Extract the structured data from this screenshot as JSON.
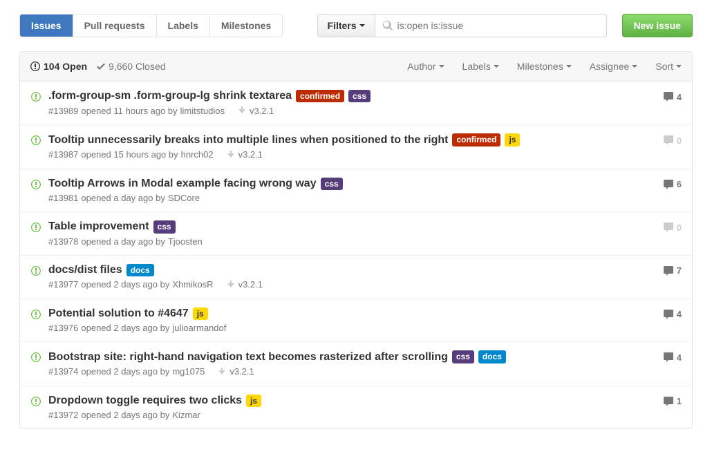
{
  "tabs": {
    "issues": "Issues",
    "pulls": "Pull requests",
    "labels": "Labels",
    "milestones": "Milestones"
  },
  "filters_label": "Filters",
  "search_value": "is:open is:issue",
  "new_issue_label": "New issue",
  "states": {
    "open": "104 Open",
    "closed": "9,660 Closed"
  },
  "sorts": {
    "author": "Author",
    "labels": "Labels",
    "milestones": "Milestones",
    "assignee": "Assignee",
    "sort": "Sort"
  },
  "label_colors": {
    "confirmed": "#bd2c00",
    "css": "#563d7c",
    "js": "#ffd804",
    "docs": "#0088cc"
  },
  "issues": [
    {
      "title": ".form-group-sm .form-group-lg shrink textarea",
      "labels": [
        "confirmed",
        "css"
      ],
      "number": "#13989",
      "opened": "opened 11 hours ago by",
      "author": "limitstudios",
      "milestone": "v3.2.1",
      "comments": 4
    },
    {
      "title": "Tooltip unnecessarily breaks into multiple lines when positioned to the right",
      "labels": [
        "confirmed",
        "js"
      ],
      "number": "#13987",
      "opened": "opened 15 hours ago by",
      "author": "hnrch02",
      "milestone": "v3.2.1",
      "comments": 0
    },
    {
      "title": "Tooltip Arrows in Modal example facing wrong way",
      "labels": [
        "css"
      ],
      "number": "#13981",
      "opened": "opened a day ago by",
      "author": "SDCore",
      "milestone": "",
      "comments": 6
    },
    {
      "title": "Table improvement",
      "labels": [
        "css"
      ],
      "number": "#13978",
      "opened": "opened a day ago by",
      "author": "Tjoosten",
      "milestone": "",
      "comments": 0
    },
    {
      "title": "docs/dist files",
      "labels": [
        "docs"
      ],
      "number": "#13977",
      "opened": "opened 2 days ago by",
      "author": "XhmikosR",
      "milestone": "v3.2.1",
      "comments": 7
    },
    {
      "title": "Potential solution to #4647",
      "labels": [
        "js"
      ],
      "number": "#13976",
      "opened": "opened 2 days ago by",
      "author": "julioarmandof",
      "milestone": "",
      "comments": 4
    },
    {
      "title": "Bootstrap site: right-hand navigation text becomes rasterized after scrolling",
      "labels": [
        "css",
        "docs"
      ],
      "number": "#13974",
      "opened": "opened 2 days ago by",
      "author": "mg1075",
      "milestone": "v3.2.1",
      "comments": 4
    },
    {
      "title": "Dropdown toggle requires two clicks",
      "labels": [
        "js"
      ],
      "number": "#13972",
      "opened": "opened 2 days ago by",
      "author": "Kizmar",
      "milestone": "",
      "comments": 1
    }
  ]
}
